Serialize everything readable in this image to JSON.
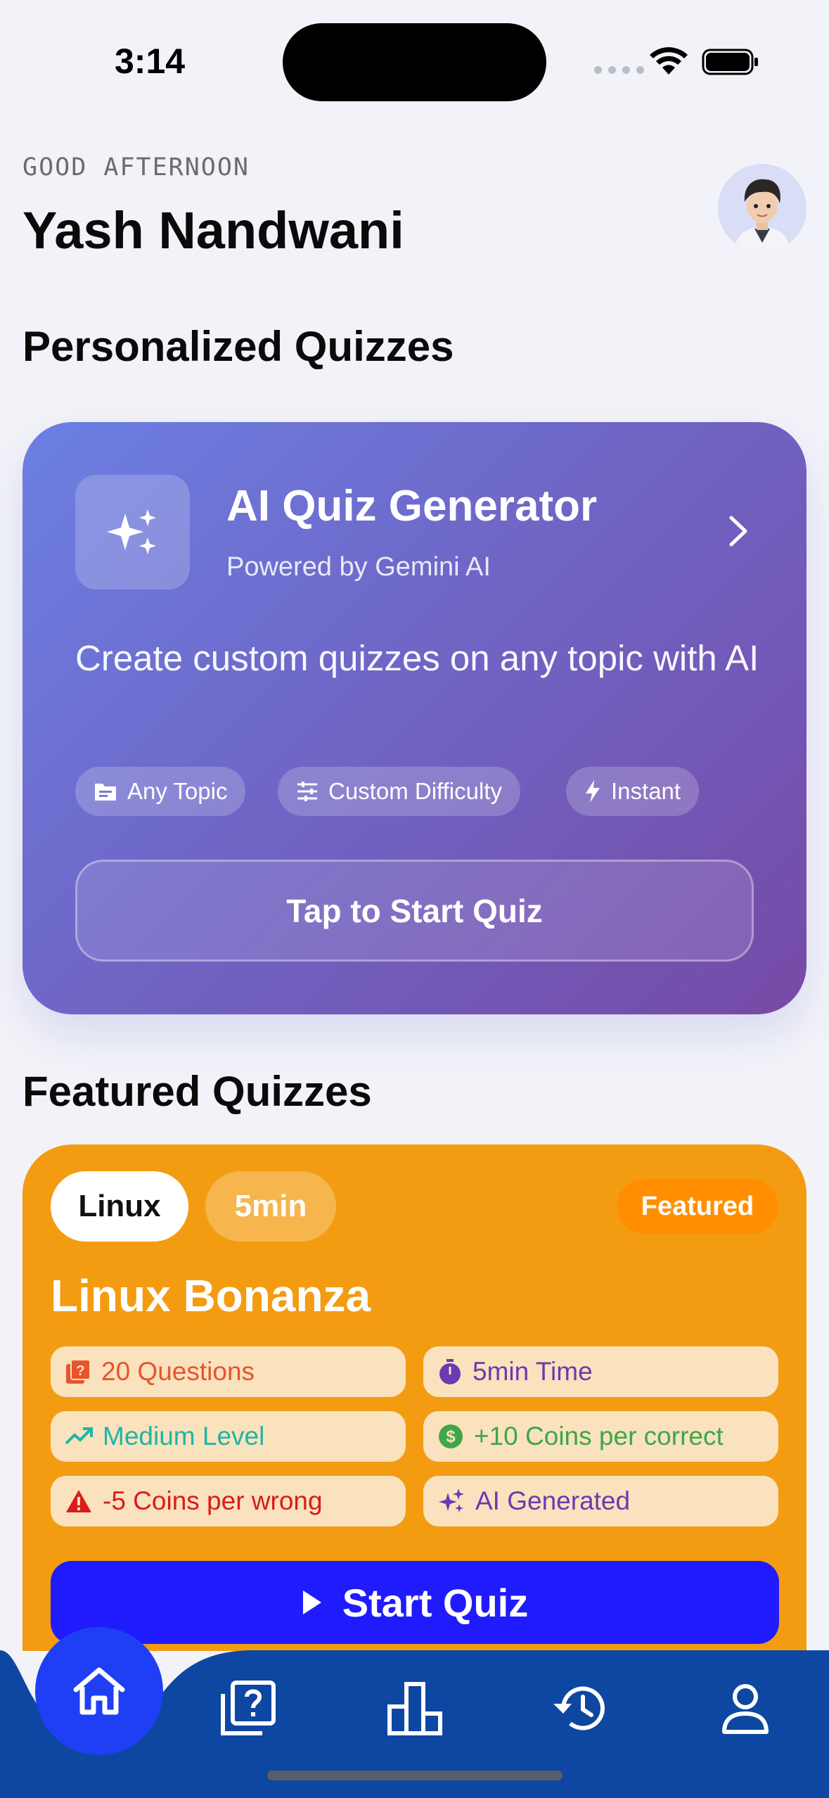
{
  "status": {
    "time": "3:14"
  },
  "header": {
    "greeting": "GOOD AFTERNOON",
    "user_name": "Yash Nandwani"
  },
  "sections": {
    "personalized": "Personalized Quizzes",
    "featured": "Featured Quizzes"
  },
  "ai_card": {
    "title": "AI Quiz Generator",
    "subtitle": "Powered by Gemini AI",
    "description": "Create custom quizzes on any topic with AI",
    "chips": [
      {
        "label": "Any Topic",
        "icon": "folder-icon"
      },
      {
        "label": "Custom Difficulty",
        "icon": "sliders-icon"
      },
      {
        "label": "Instant",
        "icon": "bolt-icon"
      }
    ],
    "cta": "Tap to Start Quiz"
  },
  "featured_quiz": {
    "tag": "Linux",
    "duration": "5min",
    "badge": "Featured",
    "title": "Linux Bonanza",
    "stats": [
      {
        "label": "20 Questions",
        "icon": "quiz-icon",
        "color": "#e8542c"
      },
      {
        "label": "5min Time",
        "icon": "timer-icon",
        "color": "#6a3bb0"
      },
      {
        "label": "Medium Level",
        "icon": "trend-up-icon",
        "color": "#1fb5a6"
      },
      {
        "label": "+10 Coins per correct",
        "icon": "coin-icon",
        "color": "#3fa64a"
      },
      {
        "label": "-5 Coins per wrong",
        "icon": "warning-icon",
        "color": "#d91c1c"
      },
      {
        "label": "AI Generated",
        "icon": "sparkle-icon",
        "color": "#6a3bb0"
      }
    ],
    "cta": "Start Quiz"
  },
  "colors": {
    "background": "#f2f3f8",
    "featured_card": "#f39c12",
    "start_button": "#1f1bfd",
    "nav_bar": "#0d47a1",
    "home_fab": "#1f3ff5"
  }
}
